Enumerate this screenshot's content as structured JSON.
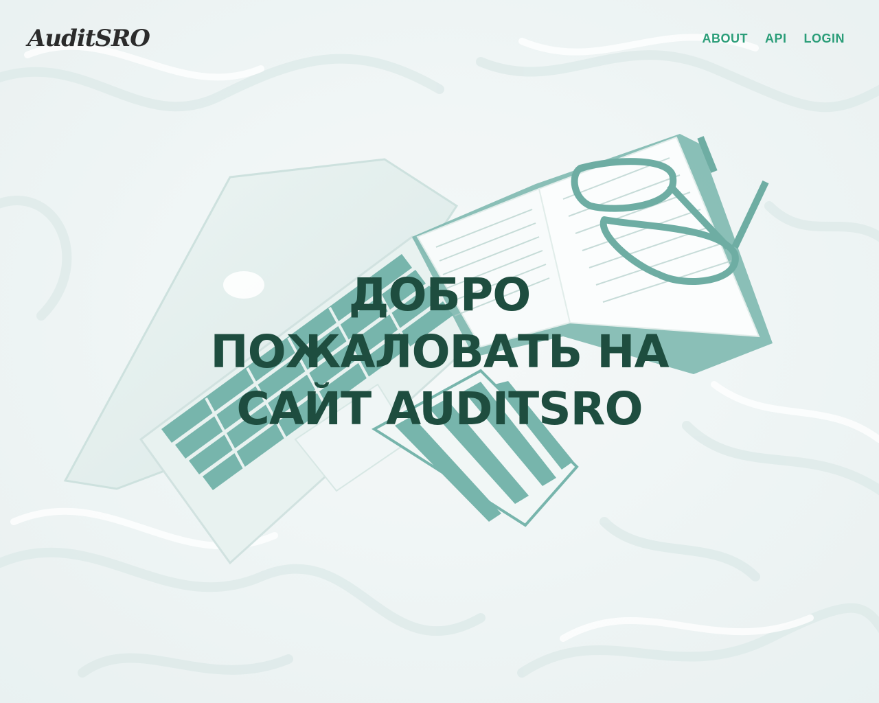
{
  "header": {
    "logo_text": "AuditSRO",
    "nav": {
      "about": "ABOUT",
      "api": "API",
      "login": "LOGIN"
    }
  },
  "hero": {
    "line1": "ДОБРО",
    "line2": "ПОЖАЛОВАТЬ НА",
    "line3": "САЙТ AUDITSRO"
  },
  "colors": {
    "nav_link": "#2a9d78",
    "heading": "#1e4d3f",
    "logo": "#2b2b2b",
    "accent_teal": "#5aa59a"
  }
}
